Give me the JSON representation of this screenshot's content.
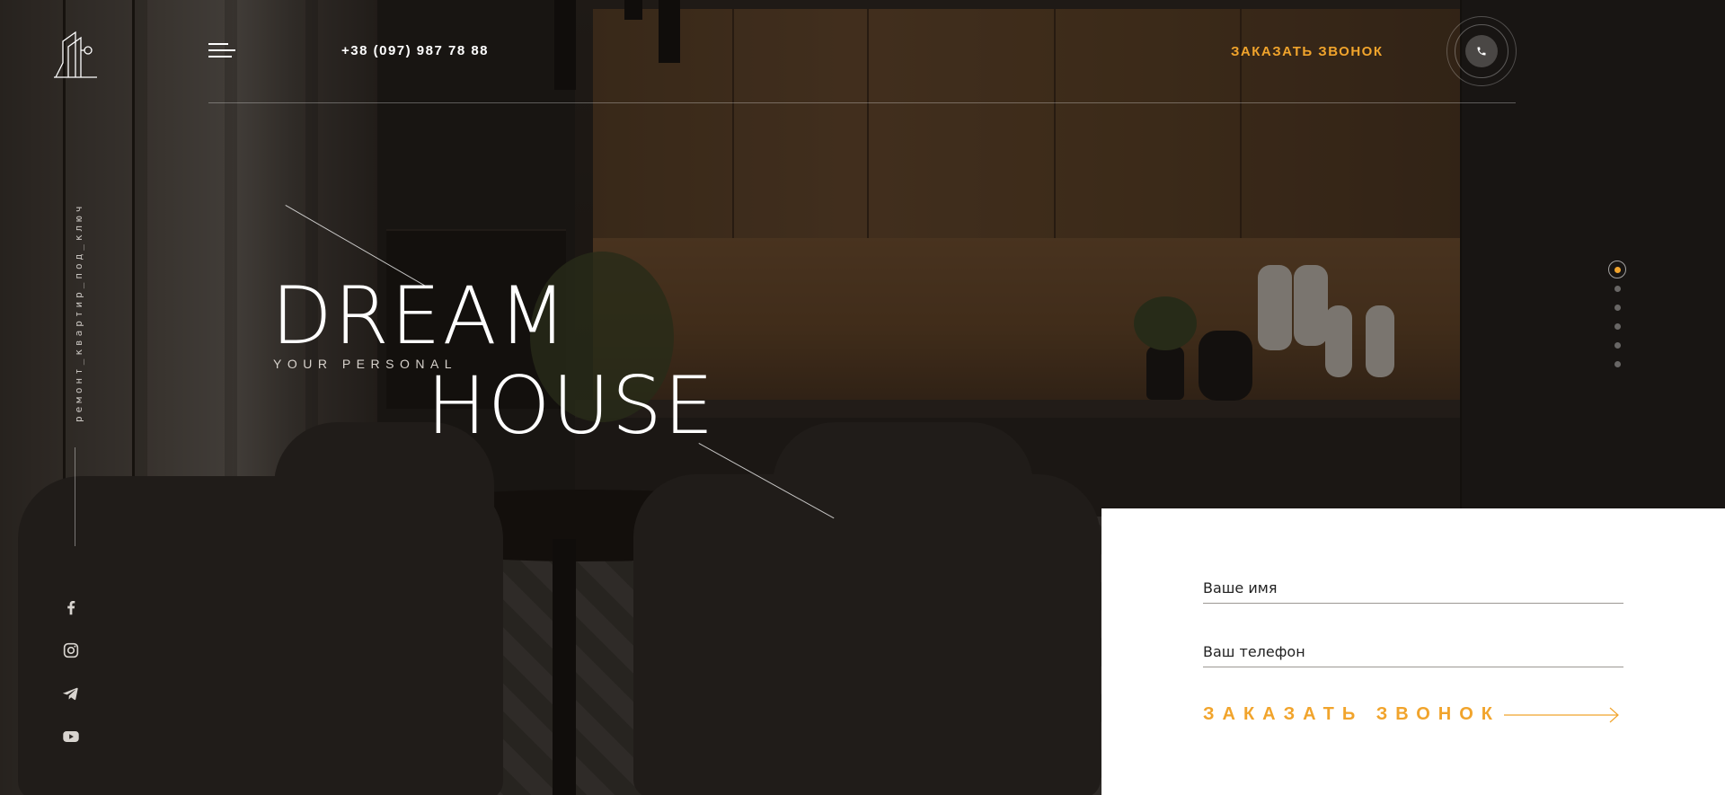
{
  "brand": {
    "tagline_vertical": "ремонт_квартир_под_ключ"
  },
  "header": {
    "phone": "+38 (097) 987 78 88",
    "call_link": "ЗАКАЗАТЬ ЗВОНОК"
  },
  "hero": {
    "title_top": "DREAM",
    "subtitle": "YOUR PERSONAL",
    "title_bottom": "HOUSE"
  },
  "socials": [
    "facebook-icon",
    "instagram-icon",
    "telegram-icon",
    "youtube-icon"
  ],
  "slider": {
    "total": 6,
    "active": 1
  },
  "form": {
    "name_placeholder": "Ваше имя",
    "phone_placeholder": "Ваш телефон",
    "submit_label": "ЗАКАЗАТЬ ЗВОНОК"
  },
  "colors": {
    "accent": "#f1a42c",
    "text": "#ffffff",
    "panel": "#ffffff"
  }
}
